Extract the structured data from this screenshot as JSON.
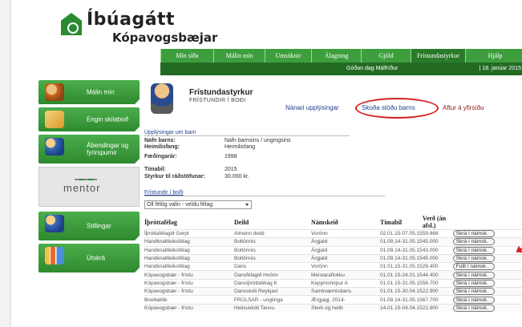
{
  "header": {
    "logo_title": "Íbúagátt",
    "logo_sub": "Kópavogsbæjar"
  },
  "topnav": [
    {
      "label": "Mín síða",
      "w": 66
    },
    {
      "label": "Málin mín",
      "w": 64
    },
    {
      "label": "Umsóknir",
      "w": 58
    },
    {
      "label": "Álagning",
      "w": 62
    },
    {
      "label": "Gjöld",
      "w": 62
    },
    {
      "label": "Frístundastyrkur",
      "w": 68
    },
    {
      "label": "Hjálp",
      "w": 74
    }
  ],
  "subnav": {
    "user": "Góðan dag Málfríður",
    "date": "| 18. janúar 2015"
  },
  "sidebar": {
    "items": [
      {
        "label": "Málin mín"
      },
      {
        "label": "Engin skilaboð"
      },
      {
        "label": "Ábendingar og fyrirspurnir"
      },
      {
        "label": "Stillingar"
      },
      {
        "label": "Útskrá"
      }
    ],
    "mentor": "mentor"
  },
  "main": {
    "title": "Frístundastyrkur",
    "subtitle": "FRÍSTUNDIR Í BOÐI",
    "link_info": "Nánari upplýsingar",
    "link_status": "Skoða stöðu barns",
    "link_back": "Aftur á yfirsíðu",
    "section_info": "Upplýsingar um barn",
    "fields": [
      {
        "k": "Nafn barns:",
        "v": "Nafn barnsins / ungingsins"
      },
      {
        "k": "Heimilisfang:",
        "v": "Heimilisfang"
      },
      {
        "k": "Fæðingarár:",
        "v": "1998"
      },
      {
        "k": "Tímabil:",
        "v": "2015"
      },
      {
        "k": "Styrkur til ráðstöfunar:",
        "v": "30.000 kr."
      }
    ],
    "section_boi": "Frístundir í boði",
    "filter_value": "Öll félög valin - veldu félag",
    "table": {
      "headers": [
        "Íþróttafélag",
        "Deild",
        "Námskeið",
        "Tímabil",
        "Verð (án afsl.)",
        ""
      ],
      "rows": [
        [
          "Íþróttafélagið Gerpl",
          "Almenn deild",
          "Vorönn",
          "02.01.15-07.05.15",
          "59.868",
          "Skrá í námsk."
        ],
        [
          "Handknattleiksfélag",
          "Boltönnis",
          "Árgjald",
          "01.09.14-31.05.15",
          "45.000",
          "Skrá í námsk."
        ],
        [
          "Handknattleiksfélag",
          "Boltönnis",
          "Árgjald",
          "01.09.14-31.05.15",
          "43.000",
          "Skrá í námsk."
        ],
        [
          "Handknattleiksfélag",
          "Boltönnis",
          "Árgjald",
          "01.09.14-31.05.15",
          "45.000",
          "Skrá í námsk."
        ],
        [
          "Handknattleiksfélag",
          "Dans",
          "Vorönn",
          "01.01.15-31.05.15",
          "29.400",
          "Fullt í námsk."
        ],
        [
          "Kópavogsbær - frístu",
          "Dansfélagið Hvönn",
          "Meistaraflokku",
          "01.01.15-24.01.15",
          "44.400",
          "Skrá í námsk."
        ],
        [
          "Kópavogsbær - frístu",
          "Dansíþróttafélag K",
          "Keppnishópur A",
          "01.01.15-31.05.15",
          "56.700",
          "Skrá í námsk."
        ],
        [
          "Kópavogsbær - frístu",
          "Dansskóli Reykjavi",
          "Samkvæmisdans",
          "01.01.15-30.04.15",
          "22.900",
          "Skrá í námsk."
        ],
        [
          "Breiðablik",
          "FRÚLSAR - unglinga",
          "Ærgjagj. 2014-",
          "01.09.14-31.05.15",
          "67.700",
          "Skrá í námsk."
        ],
        [
          "Kópavogsbær - frístu",
          "Heilsuskóli Tanvu",
          "Sterk og heilb",
          "14.01.15-04.04.15",
          "22.900",
          "Skrá í námsk."
        ]
      ]
    }
  },
  "colors": {
    "nav_green": "#3e9e3e",
    "subnav_green": "#236b23",
    "highlight_red": "#d62020"
  }
}
